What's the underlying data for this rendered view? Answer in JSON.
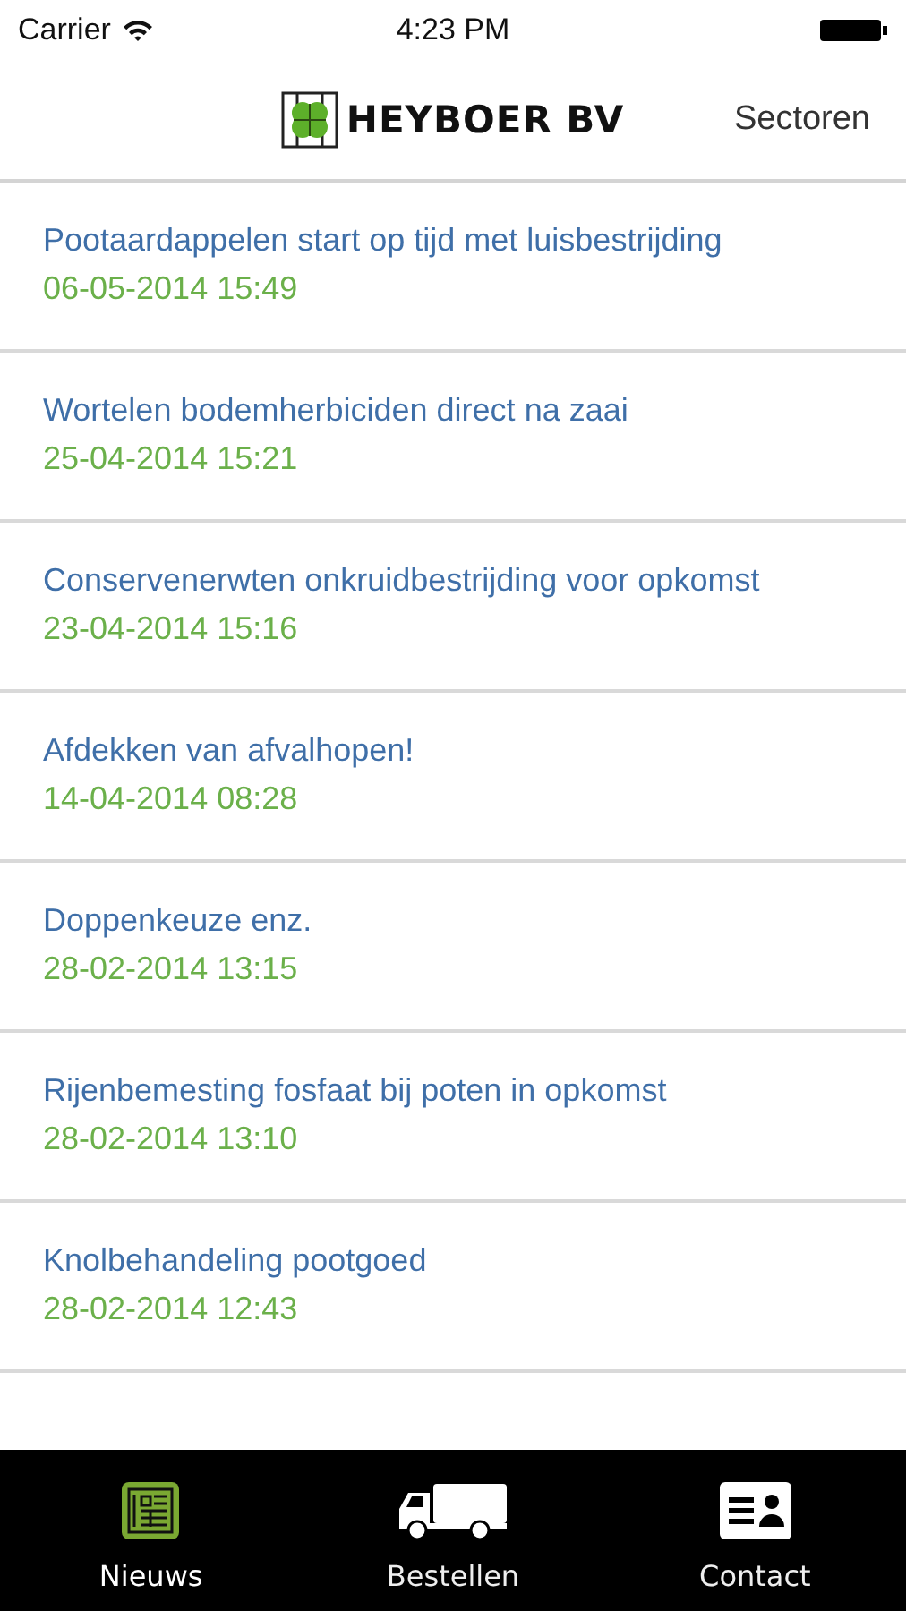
{
  "status_bar": {
    "carrier": "Carrier",
    "time": "4:23 PM"
  },
  "nav_bar": {
    "logo_text": "HEYBOER BV",
    "right_button": "Sectoren"
  },
  "news": [
    {
      "title": "Pootaardappelen start op tijd met luisbestrijding",
      "date": "06-05-2014 15:49"
    },
    {
      "title": "Wortelen bodemherbiciden direct na zaai",
      "date": "25-04-2014 15:21"
    },
    {
      "title": "Conservenerwten onkruidbestrijding voor opkomst",
      "date": "23-04-2014 15:16"
    },
    {
      "title": "Afdekken van afvalhopen!",
      "date": "14-04-2014 08:28"
    },
    {
      "title": "Doppenkeuze enz.",
      "date": "28-02-2014 13:15"
    },
    {
      "title": "Rijenbemesting fosfaat bij poten in opkomst",
      "date": "28-02-2014 13:10"
    },
    {
      "title": "Knolbehandeling pootgoed",
      "date": "28-02-2014 12:43"
    }
  ],
  "tabs": [
    {
      "kind": "news",
      "label": "Nieuws",
      "selected": true
    },
    {
      "kind": "truck",
      "label": "Bestellen",
      "selected": false
    },
    {
      "kind": "contact",
      "label": "Contact",
      "selected": false
    }
  ]
}
